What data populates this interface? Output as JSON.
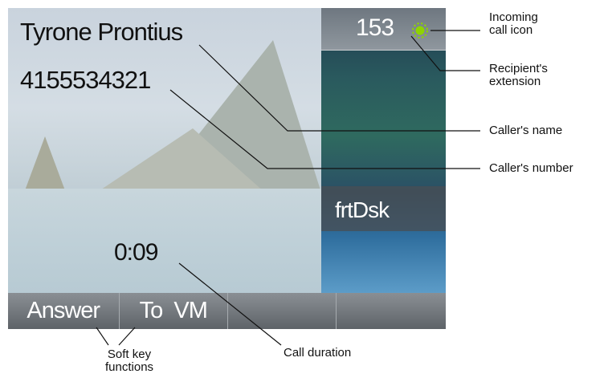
{
  "screen": {
    "caller_name": "Tyrone Prontius",
    "caller_number": "4155534321",
    "extension": "153",
    "line_label": "frtDsk",
    "call_duration": "0:09",
    "softkeys": [
      "Answer",
      "To  VM",
      "",
      ""
    ],
    "incoming_icon": "incoming-call-icon",
    "incoming_icon_color": "#8fd400"
  },
  "callouts": {
    "incoming_icon": [
      "Incoming",
      "call icon"
    ],
    "extension": [
      "Recipient's",
      "extension"
    ],
    "caller_name": "Caller's name",
    "caller_number": "Caller's number",
    "softkeys": [
      "Soft key",
      "functions"
    ],
    "duration": "Call duration"
  }
}
